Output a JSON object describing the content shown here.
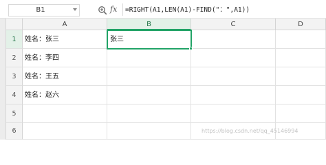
{
  "formula_bar": {
    "name_box": "B1",
    "fx_label": "fx",
    "formula": "=RIGHT(A1,LEN(A1)-FIND(\"：\",A1))"
  },
  "columns": [
    "A",
    "B",
    "C",
    "D"
  ],
  "rows": [
    "1",
    "2",
    "3",
    "4",
    "5",
    "6"
  ],
  "cells": {
    "A1": "姓名：张三",
    "A2": "姓名：李四",
    "A3": "姓名：王五",
    "A4": "姓名：赵六",
    "B1": "张三"
  },
  "selected_cell": "B1",
  "watermark": "https://blog.csdn.net/qq_45146994",
  "colors": {
    "accent": "#21a366",
    "header_bg": "#f3f3f3",
    "gridline": "#e2e2e2"
  }
}
